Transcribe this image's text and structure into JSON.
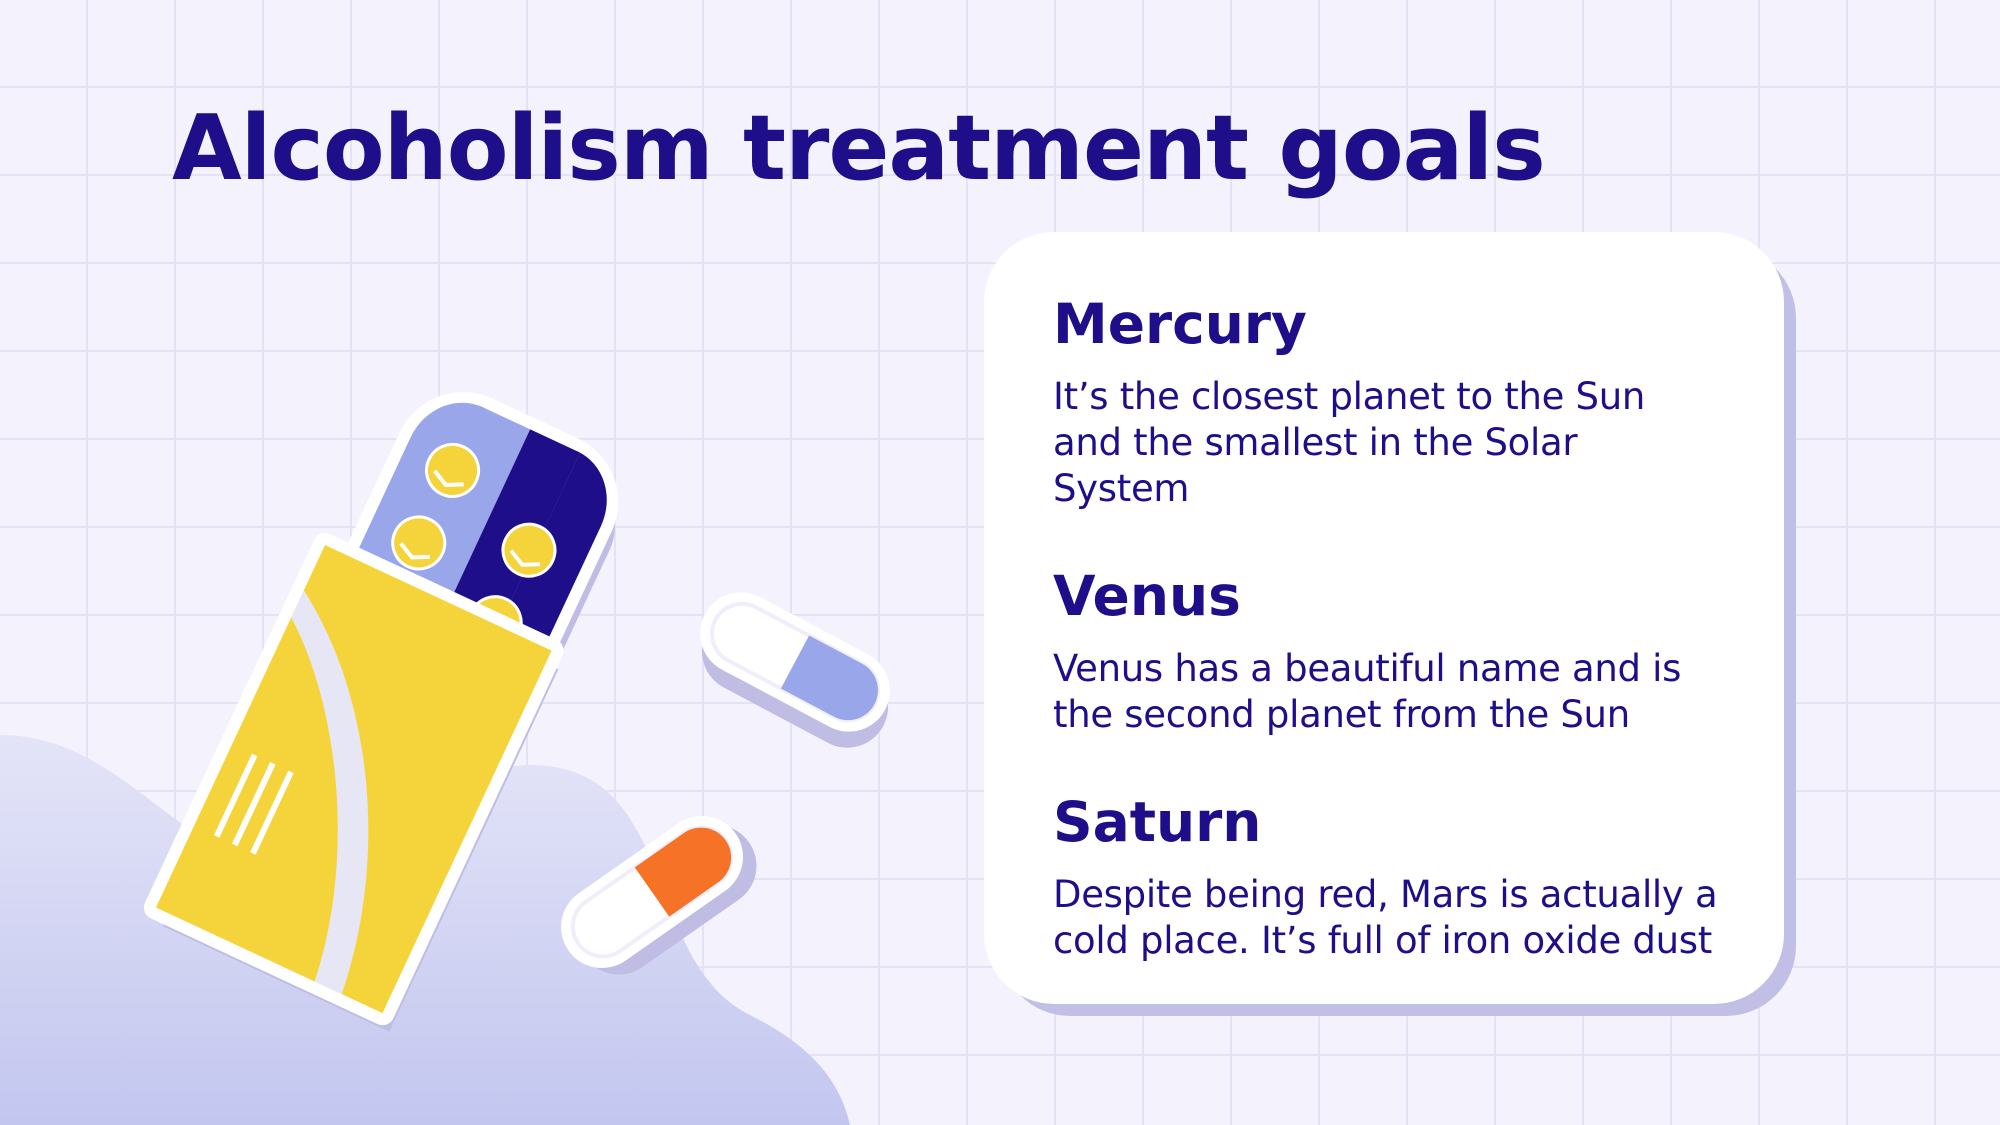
{
  "slide": {
    "title": "Alcoholism treatment goals"
  },
  "card": {
    "items": [
      {
        "title": "Mercury",
        "description": "It’s the closest planet to the Sun and the smallest in the Solar System"
      },
      {
        "title": "Venus",
        "description": "Venus has a beautiful name and is the second planet from the Sun"
      },
      {
        "title": "Saturn",
        "description": "Despite being red, Mars is actually a cold place. It’s full of iron oxide dust"
      }
    ]
  },
  "colors": {
    "navy": "#1e0e8a",
    "lavender": "#9aa6ea",
    "yellow": "#f5d33a",
    "orange": "#f57226",
    "background": "#f4f3fd",
    "shadow": "#c2bfe6"
  }
}
